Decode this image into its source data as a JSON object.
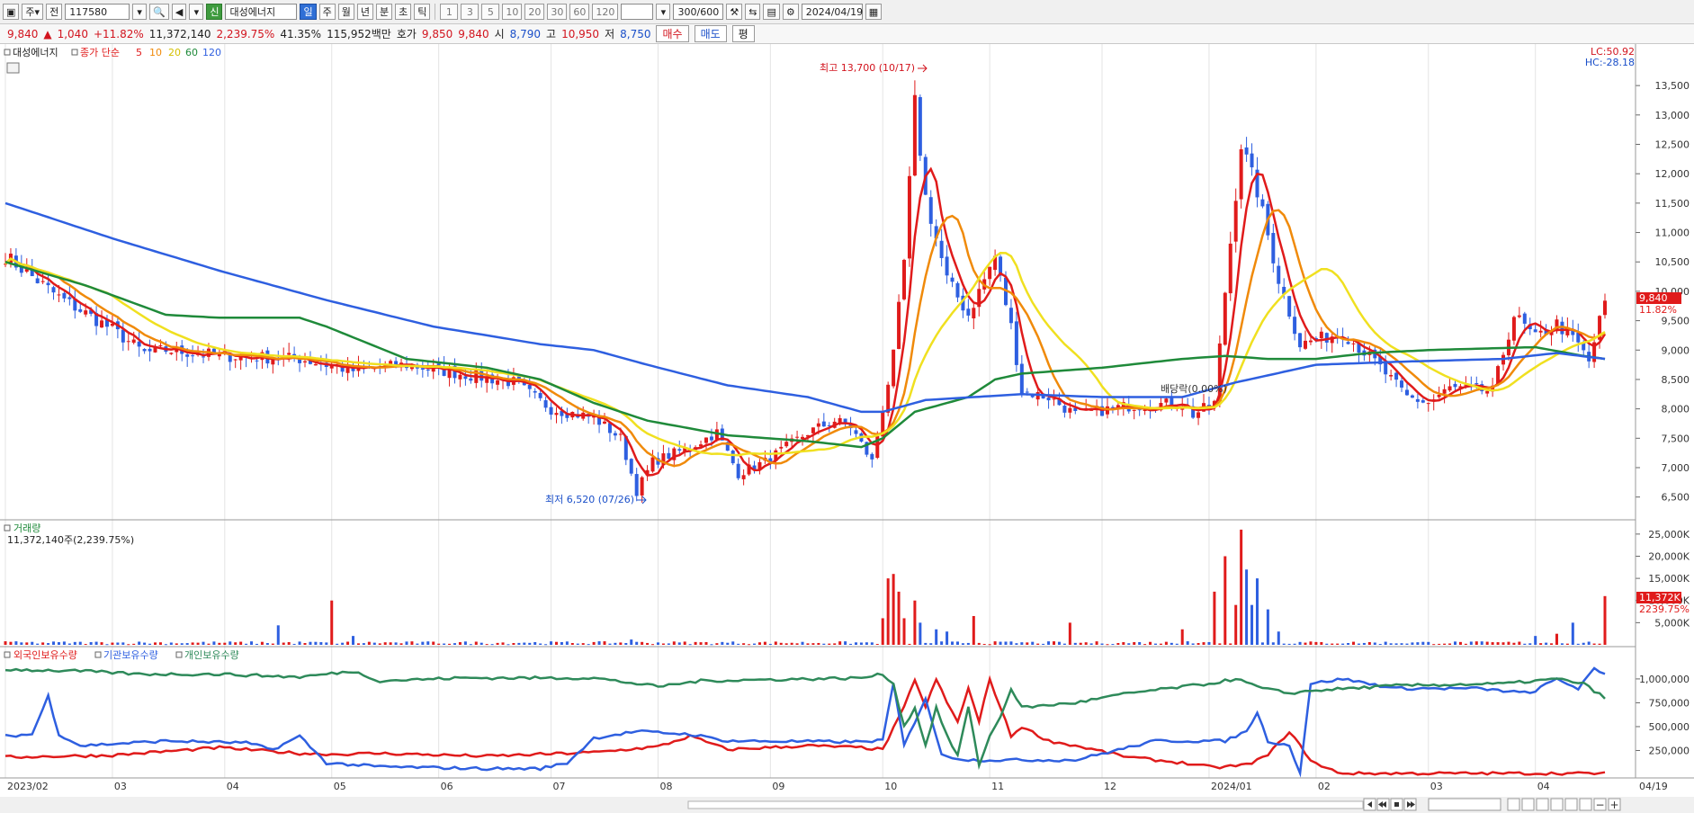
{
  "toolbar": {
    "market": "주",
    "type": "전",
    "code": "117580",
    "badge": "신",
    "name": "대성에너지",
    "periods": [
      "일",
      "주",
      "월",
      "년",
      "분",
      "초",
      "틱"
    ],
    "active_period": "일",
    "minutes": [
      "1",
      "3",
      "5",
      "10",
      "20",
      "30",
      "60",
      "120"
    ],
    "count": "300/600",
    "date": "2024/04/19"
  },
  "quote": {
    "price": "9,840",
    "arrow": "▲",
    "change": "1,040",
    "change_pct": "+11.82%",
    "volume": "11,372,140",
    "volume_pct": "2,239.75%",
    "turnover": "41.35%",
    "amount": "115,952백만",
    "bid_label": "호가",
    "bid1": "9,850",
    "bid2": "9,840",
    "open_label": "시",
    "open": "8,790",
    "high_label": "고",
    "high": "10,950",
    "low_label": "저",
    "low": "8,750",
    "buy": "매수",
    "sell": "매도",
    "eval": "평"
  },
  "panels": {
    "price_title": "대성에너지",
    "ma_label": "종가 단순",
    "ma_periods": [
      "5",
      "10",
      "20",
      "60",
      "120"
    ],
    "ma_colors": [
      "#e01b1b",
      "#f08a0a",
      "#f0e020",
      "#1f8a3a",
      "#2e5fe0"
    ],
    "lc": "LC:50.92",
    "hc": "HC:-28.18",
    "max_note": "최고 13,700 (10/17)",
    "min_note": "최저 6,520 (07/26)",
    "dividend_note": "배당락(0.00%)",
    "last_price_tag": "9,840",
    "last_pct_tag": "11.82%",
    "volume_title": "거래량",
    "volume_value": "11,372,140주(2,239.75%)",
    "volume_tag": "11,372K",
    "volume_pct_tag": "2239.75%",
    "holdings_labels": [
      "외국인보유수량",
      "기관보유수량",
      "개인보유수량"
    ],
    "holdings_colors": [
      "#e01b1b",
      "#2e5fe0",
      "#2e8a5a"
    ],
    "end_date": "04/19"
  },
  "chart_data": {
    "type": "candlestick",
    "x_ticks": [
      "2023/02",
      "03",
      "04",
      "05",
      "06",
      "07",
      "08",
      "09",
      "10",
      "11",
      "12",
      "2024/01",
      "02",
      "03",
      "04"
    ],
    "x_tick_pos": [
      0,
      20,
      41,
      61,
      81,
      102,
      122,
      143,
      164,
      184,
      205,
      225,
      245,
      266,
      286
    ],
    "n": 300,
    "price_ylim": [
      6250,
      13900
    ],
    "price_ticks": [
      6500,
      7000,
      7500,
      8000,
      8500,
      9000,
      9500,
      10000,
      10500,
      11000,
      11500,
      12000,
      12500,
      13000,
      13500
    ],
    "price_keys": [
      [
        0,
        10600
      ],
      [
        10,
        9900
      ],
      [
        20,
        9350
      ],
      [
        26,
        8950
      ],
      [
        30,
        9000
      ],
      [
        41,
        8900
      ],
      [
        55,
        8850
      ],
      [
        65,
        8650
      ],
      [
        75,
        8750
      ],
      [
        85,
        8600
      ],
      [
        95,
        8450
      ],
      [
        102,
        8000
      ],
      [
        110,
        7850
      ],
      [
        115,
        7500
      ],
      [
        118,
        6600
      ],
      [
        121,
        7100
      ],
      [
        128,
        7350
      ],
      [
        133,
        7600
      ],
      [
        137,
        6900
      ],
      [
        142,
        7100
      ],
      [
        150,
        7600
      ],
      [
        155,
        7800
      ],
      [
        158,
        7700
      ],
      [
        162,
        7100
      ],
      [
        166,
        8900
      ],
      [
        168,
        10500
      ],
      [
        170,
        13200
      ],
      [
        172,
        11600
      ],
      [
        176,
        10200
      ],
      [
        180,
        9600
      ],
      [
        185,
        10600
      ],
      [
        188,
        9400
      ],
      [
        190,
        8300
      ],
      [
        195,
        8200
      ],
      [
        200,
        7900
      ],
      [
        210,
        8050
      ],
      [
        220,
        8100
      ],
      [
        222,
        7900
      ],
      [
        226,
        8100
      ],
      [
        228,
        10000
      ],
      [
        231,
        12500
      ],
      [
        234,
        11700
      ],
      [
        238,
        10200
      ],
      [
        242,
        9100
      ],
      [
        246,
        9200
      ],
      [
        250,
        9300
      ],
      [
        256,
        8800
      ],
      [
        262,
        8200
      ],
      [
        266,
        8100
      ],
      [
        270,
        8350
      ],
      [
        278,
        8300
      ],
      [
        282,
        9600
      ],
      [
        286,
        9200
      ],
      [
        290,
        9450
      ],
      [
        294,
        9100
      ],
      [
        296,
        8800
      ],
      [
        299,
        9840
      ]
    ],
    "ma": {
      "ma60": [
        [
          0,
          10500
        ],
        [
          15,
          10100
        ],
        [
          30,
          9600
        ],
        [
          40,
          9550
        ],
        [
          55,
          9550
        ],
        [
          60,
          9400
        ],
        [
          75,
          8850
        ],
        [
          90,
          8700
        ],
        [
          100,
          8500
        ],
        [
          110,
          8100
        ],
        [
          120,
          7800
        ],
        [
          135,
          7550
        ],
        [
          150,
          7450
        ],
        [
          160,
          7350
        ],
        [
          164,
          7500
        ],
        [
          170,
          7950
        ],
        [
          180,
          8200
        ],
        [
          185,
          8500
        ],
        [
          190,
          8600
        ],
        [
          205,
          8700
        ],
        [
          220,
          8850
        ],
        [
          228,
          8900
        ],
        [
          236,
          8850
        ],
        [
          245,
          8850
        ],
        [
          255,
          8950
        ],
        [
          266,
          9000
        ],
        [
          286,
          9050
        ],
        [
          295,
          8900
        ],
        [
          299,
          8850
        ]
      ],
      "ma120": [
        [
          0,
          11500
        ],
        [
          20,
          10900
        ],
        [
          40,
          10350
        ],
        [
          60,
          9850
        ],
        [
          80,
          9400
        ],
        [
          100,
          9100
        ],
        [
          110,
          9000
        ],
        [
          120,
          8750
        ],
        [
          135,
          8400
        ],
        [
          150,
          8200
        ],
        [
          160,
          7950
        ],
        [
          164,
          7950
        ],
        [
          172,
          8150
        ],
        [
          190,
          8250
        ],
        [
          205,
          8200
        ],
        [
          220,
          8200
        ],
        [
          230,
          8450
        ],
        [
          245,
          8750
        ],
        [
          260,
          8800
        ],
        [
          280,
          8850
        ],
        [
          290,
          8950
        ],
        [
          299,
          8850
        ]
      ]
    },
    "volume_ylim": [
      0,
      27000
    ],
    "volume_ticks": [
      5000,
      10000,
      15000,
      20000,
      25000
    ],
    "volume_spikes": [
      [
        0,
        800
      ],
      [
        20,
        500
      ],
      [
        51,
        4400
      ],
      [
        61,
        10000
      ],
      [
        65,
        2000
      ],
      [
        97,
        500
      ],
      [
        117,
        1200
      ],
      [
        164,
        6000
      ],
      [
        165,
        15000
      ],
      [
        166,
        16000
      ],
      [
        167,
        12000
      ],
      [
        168,
        6000
      ],
      [
        170,
        10000
      ],
      [
        171,
        5000
      ],
      [
        174,
        3500
      ],
      [
        176,
        3000
      ],
      [
        181,
        6500
      ],
      [
        199,
        5000
      ],
      [
        220,
        3500
      ],
      [
        221,
        800
      ],
      [
        226,
        12000
      ],
      [
        228,
        20000
      ],
      [
        230,
        9000
      ],
      [
        231,
        26000
      ],
      [
        232,
        17000
      ],
      [
        233,
        9000
      ],
      [
        234,
        15000
      ],
      [
        236,
        8000
      ],
      [
        238,
        3000
      ],
      [
        286,
        2000
      ],
      [
        290,
        2500
      ],
      [
        293,
        5000
      ],
      [
        299,
        11000
      ]
    ],
    "holdings_ylim": [
      0,
      1150000
    ],
    "holdings_ticks": [
      250000,
      500000,
      750000,
      1000000
    ],
    "foreign": [
      [
        0,
        180000
      ],
      [
        20,
        200000
      ],
      [
        40,
        280000
      ],
      [
        55,
        220000
      ],
      [
        62,
        210000
      ],
      [
        70,
        220000
      ],
      [
        90,
        190000
      ],
      [
        110,
        230000
      ],
      [
        122,
        290000
      ],
      [
        128,
        400000
      ],
      [
        135,
        260000
      ],
      [
        150,
        300000
      ],
      [
        160,
        280000
      ],
      [
        164,
        260000
      ],
      [
        168,
        700000
      ],
      [
        170,
        1000000
      ],
      [
        172,
        700000
      ],
      [
        174,
        1000000
      ],
      [
        176,
        750000
      ],
      [
        178,
        550000
      ],
      [
        180,
        900000
      ],
      [
        182,
        550000
      ],
      [
        184,
        1000000
      ],
      [
        186,
        700000
      ],
      [
        188,
        400000
      ],
      [
        190,
        500000
      ],
      [
        195,
        350000
      ],
      [
        200,
        300000
      ],
      [
        210,
        180000
      ],
      [
        220,
        120000
      ],
      [
        226,
        70000
      ],
      [
        232,
        100000
      ],
      [
        236,
        200000
      ],
      [
        240,
        450000
      ],
      [
        244,
        150000
      ],
      [
        246,
        80000
      ],
      [
        250,
        10000
      ],
      [
        270,
        10000
      ],
      [
        299,
        10000
      ]
    ],
    "institution": [
      [
        0,
        400000
      ],
      [
        5,
        420000
      ],
      [
        8,
        820000
      ],
      [
        10,
        420000
      ],
      [
        14,
        300000
      ],
      [
        30,
        350000
      ],
      [
        45,
        330000
      ],
      [
        50,
        260000
      ],
      [
        55,
        400000
      ],
      [
        60,
        120000
      ],
      [
        70,
        80000
      ],
      [
        90,
        60000
      ],
      [
        100,
        60000
      ],
      [
        105,
        120000
      ],
      [
        110,
        380000
      ],
      [
        118,
        450000
      ],
      [
        128,
        420000
      ],
      [
        135,
        350000
      ],
      [
        160,
        340000
      ],
      [
        164,
        360000
      ],
      [
        166,
        950000
      ],
      [
        168,
        300000
      ],
      [
        172,
        800000
      ],
      [
        175,
        200000
      ],
      [
        180,
        150000
      ],
      [
        200,
        150000
      ],
      [
        215,
        350000
      ],
      [
        228,
        350000
      ],
      [
        232,
        450000
      ],
      [
        234,
        650000
      ],
      [
        236,
        350000
      ],
      [
        240,
        300000
      ],
      [
        242,
        20000
      ],
      [
        244,
        950000
      ],
      [
        250,
        1000000
      ],
      [
        260,
        900000
      ],
      [
        275,
        900000
      ],
      [
        285,
        850000
      ],
      [
        290,
        1000000
      ],
      [
        294,
        900000
      ],
      [
        297,
        1100000
      ],
      [
        299,
        1050000
      ]
    ],
    "individual": [
      [
        0,
        1100000
      ],
      [
        15,
        1080000
      ],
      [
        25,
        1050000
      ],
      [
        40,
        1050000
      ],
      [
        55,
        1020000
      ],
      [
        65,
        1080000
      ],
      [
        70,
        980000
      ],
      [
        85,
        1010000
      ],
      [
        110,
        1010000
      ],
      [
        118,
        950000
      ],
      [
        122,
        920000
      ],
      [
        130,
        980000
      ],
      [
        150,
        1000000
      ],
      [
        160,
        1010000
      ],
      [
        164,
        1050000
      ],
      [
        166,
        950000
      ],
      [
        168,
        500000
      ],
      [
        170,
        700000
      ],
      [
        172,
        300000
      ],
      [
        174,
        700000
      ],
      [
        176,
        400000
      ],
      [
        178,
        200000
      ],
      [
        180,
        700000
      ],
      [
        182,
        100000
      ],
      [
        184,
        400000
      ],
      [
        186,
        600000
      ],
      [
        188,
        900000
      ],
      [
        190,
        700000
      ],
      [
        200,
        750000
      ],
      [
        210,
        850000
      ],
      [
        225,
        950000
      ],
      [
        230,
        1000000
      ],
      [
        235,
        900000
      ],
      [
        240,
        850000
      ],
      [
        245,
        880000
      ],
      [
        260,
        930000
      ],
      [
        280,
        950000
      ],
      [
        290,
        1000000
      ],
      [
        295,
        950000
      ],
      [
        299,
        800000
      ]
    ]
  }
}
